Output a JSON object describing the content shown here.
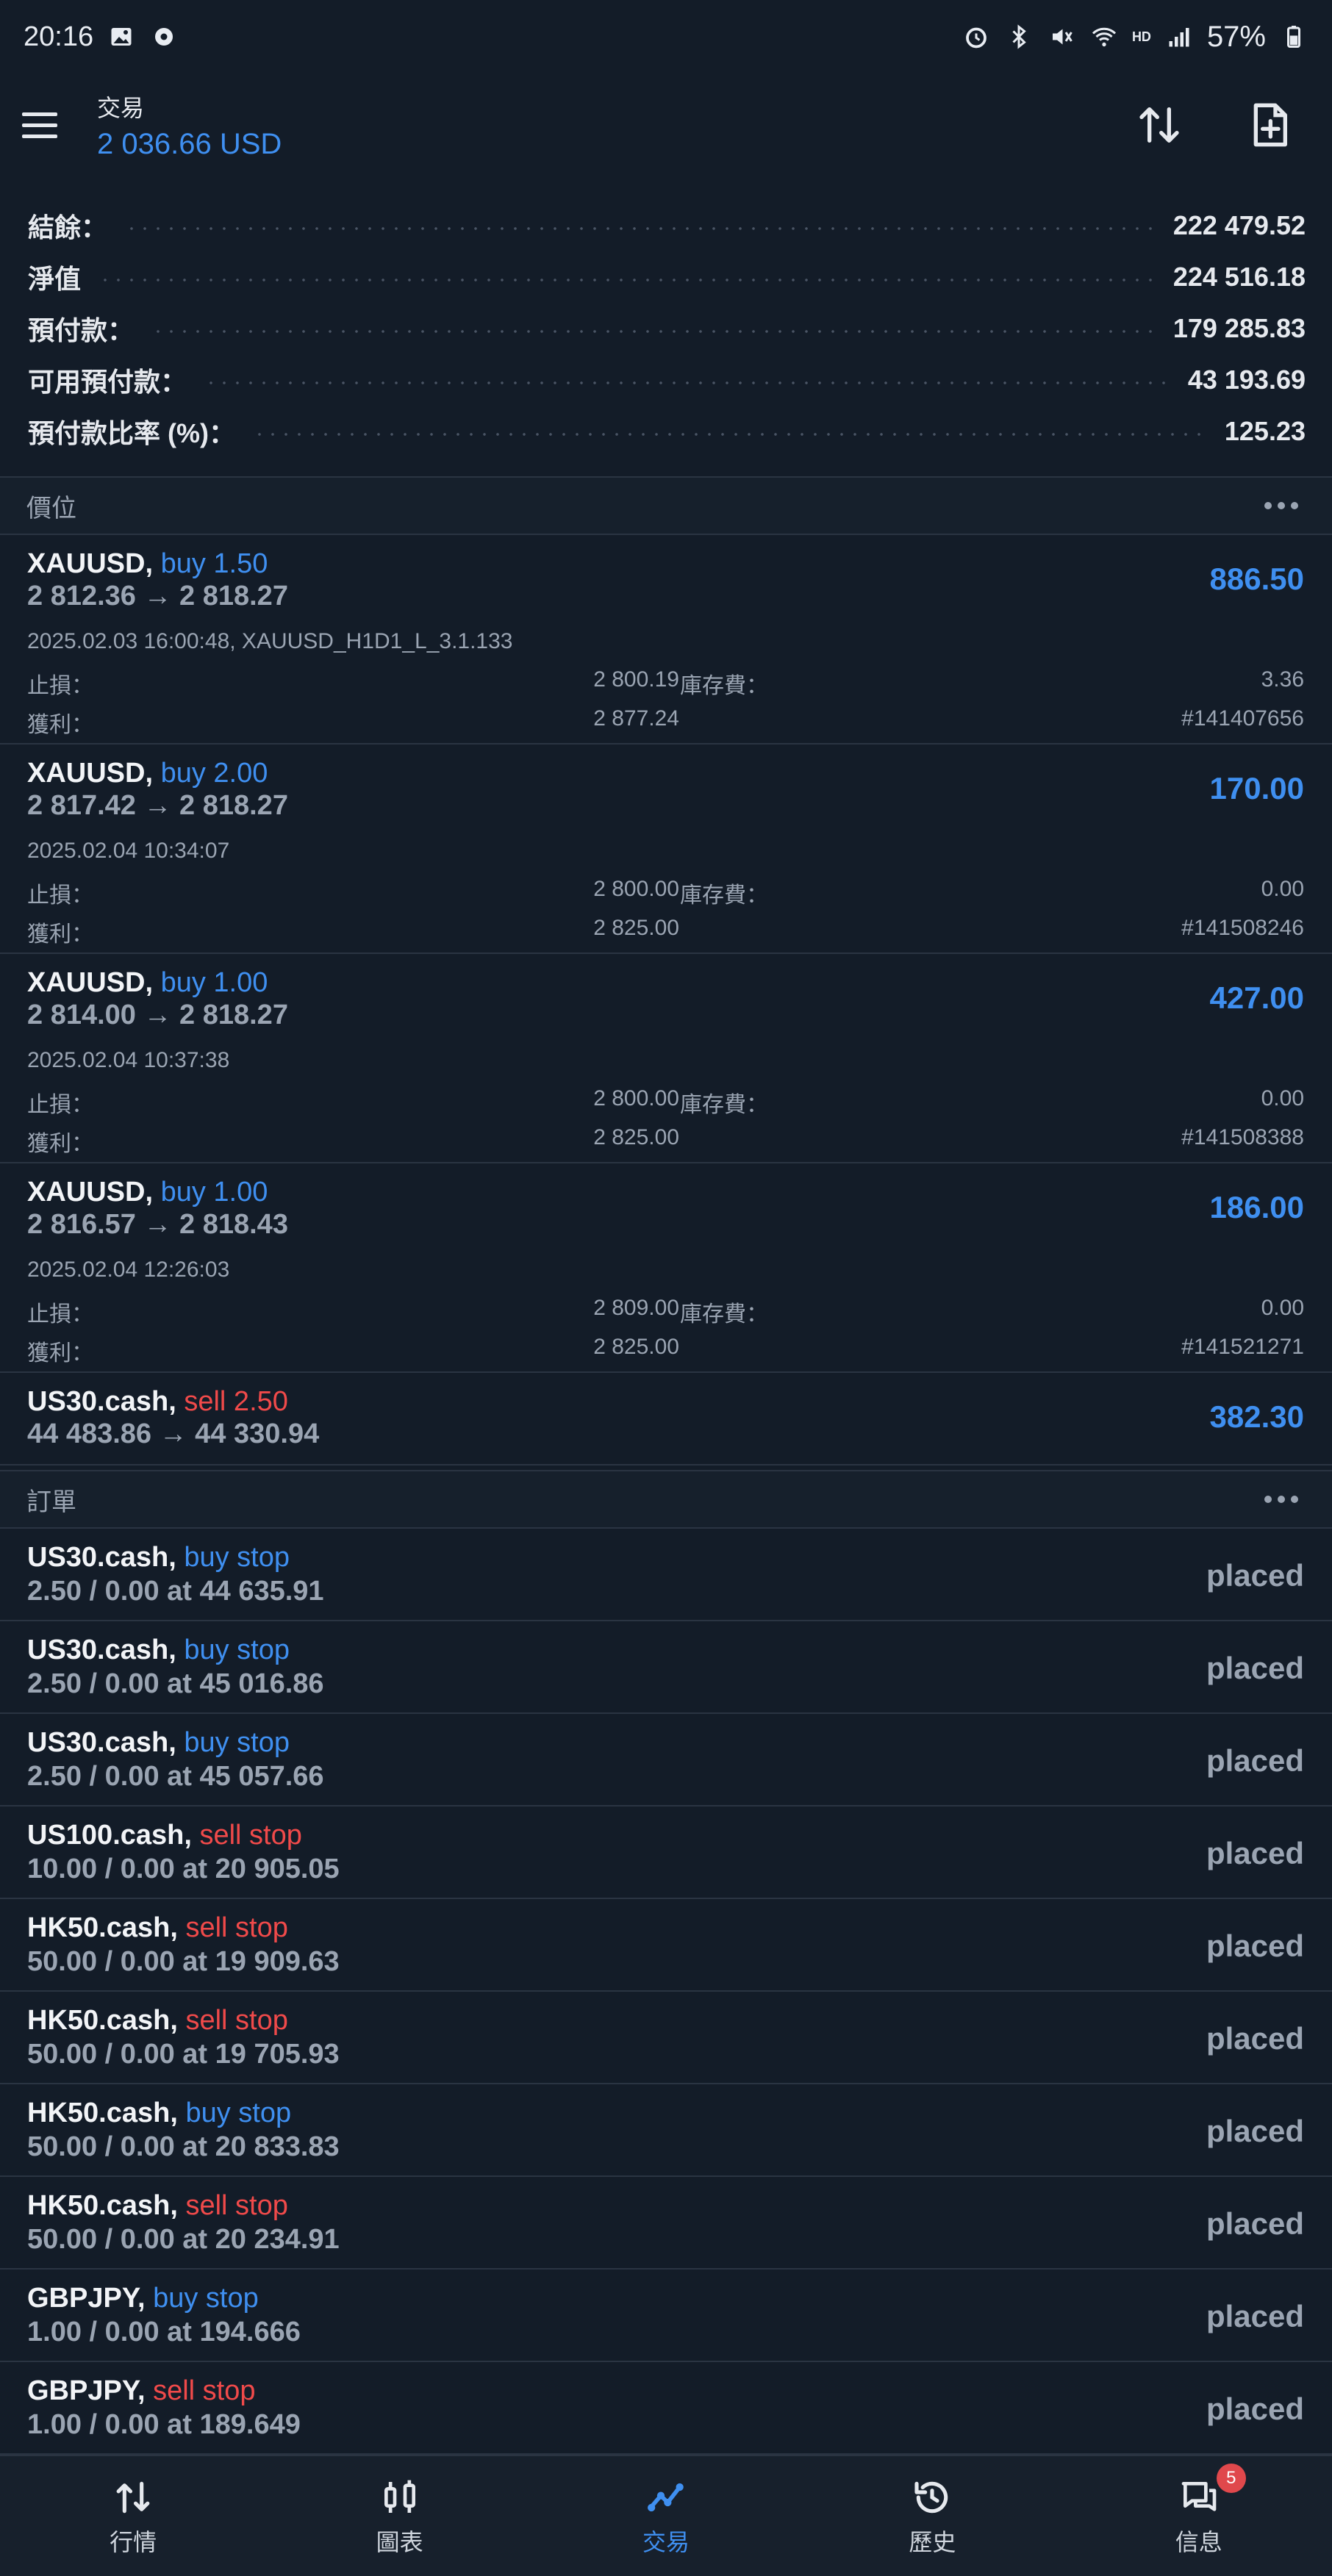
{
  "statusbar": {
    "time": "20:16",
    "hd": "HD",
    "battery": "57%"
  },
  "header": {
    "title": "交易",
    "balance": "2 036.66 USD"
  },
  "summary": [
    {
      "label": "結餘：",
      "value": "222 479.52"
    },
    {
      "label": "淨值",
      "value": "224 516.18"
    },
    {
      "label": "預付款：",
      "value": "179 285.83"
    },
    {
      "label": "可用預付款：",
      "value": "43 193.69"
    },
    {
      "label": "預付款比率 (%)：",
      "value": "125.23"
    }
  ],
  "positions_header": "價位",
  "positions": [
    {
      "symbol": "XAUUSD,",
      "side": "buy 1.50",
      "prices": "2 812.36 → 2 818.27",
      "profit": "886.50",
      "time": "2025.02.03 16:00:48, XAUUSD_H1D1_L_3.1.133",
      "sl_label": "止損：",
      "sl": "2 800.19",
      "swap_label": "庫存費：",
      "swap": "3.36",
      "tp_label": "獲利：",
      "tp": "2 877.24",
      "ticket": "#141407656"
    },
    {
      "symbol": "XAUUSD,",
      "side": "buy 2.00",
      "prices": "2 817.42 → 2 818.27",
      "profit": "170.00",
      "time": "2025.02.04 10:34:07",
      "sl_label": "止損：",
      "sl": "2 800.00",
      "swap_label": "庫存費：",
      "swap": "0.00",
      "tp_label": "獲利：",
      "tp": "2 825.00",
      "ticket": "#141508246"
    },
    {
      "symbol": "XAUUSD,",
      "side": "buy 1.00",
      "prices": "2 814.00 → 2 818.27",
      "profit": "427.00",
      "time": "2025.02.04 10:37:38",
      "sl_label": "止損：",
      "sl": "2 800.00",
      "swap_label": "庫存費：",
      "swap": "0.00",
      "tp_label": "獲利：",
      "tp": "2 825.00",
      "ticket": "#141508388"
    },
    {
      "symbol": "XAUUSD,",
      "side": "buy 1.00",
      "prices": "2 816.57 → 2 818.43",
      "profit": "186.00",
      "time": "2025.02.04 12:26:03",
      "sl_label": "止損：",
      "sl": "2 809.00",
      "swap_label": "庫存費：",
      "swap": "0.00",
      "tp_label": "獲利：",
      "tp": "2 825.00",
      "ticket": "#141521271"
    }
  ],
  "position_short": {
    "symbol": "US30.cash,",
    "side": "sell 2.50",
    "prices": "44 483.86 → 44 330.94",
    "profit": "382.30"
  },
  "orders_header": "訂單",
  "orders": [
    {
      "symbol": "US30.cash,",
      "type": "buy stop",
      "detail": "2.50 / 0.00 at 44 635.91",
      "status": "placed"
    },
    {
      "symbol": "US30.cash,",
      "type": "buy stop",
      "detail": "2.50 / 0.00 at 45 016.86",
      "status": "placed"
    },
    {
      "symbol": "US30.cash,",
      "type": "buy stop",
      "detail": "2.50 / 0.00 at 45 057.66",
      "status": "placed"
    },
    {
      "symbol": "US100.cash,",
      "type": "sell stop",
      "detail": "10.00 / 0.00 at 20 905.05",
      "status": "placed"
    },
    {
      "symbol": "HK50.cash,",
      "type": "sell stop",
      "detail": "50.00 / 0.00 at 19 909.63",
      "status": "placed"
    },
    {
      "symbol": "HK50.cash,",
      "type": "sell stop",
      "detail": "50.00 / 0.00 at 19 705.93",
      "status": "placed"
    },
    {
      "symbol": "HK50.cash,",
      "type": "buy stop",
      "detail": "50.00 / 0.00 at 20 833.83",
      "status": "placed"
    },
    {
      "symbol": "HK50.cash,",
      "type": "sell stop",
      "detail": "50.00 / 0.00 at 20 234.91",
      "status": "placed"
    },
    {
      "symbol": "GBPJPY,",
      "type": "buy stop",
      "detail": "1.00 / 0.00 at 194.666",
      "status": "placed"
    },
    {
      "symbol": "GBPJPY,",
      "type": "sell stop",
      "detail": "1.00 / 0.00 at 189.649",
      "status": "placed"
    }
  ],
  "nav": [
    {
      "label": "行情",
      "icon": "quotes-icon"
    },
    {
      "label": "圖表",
      "icon": "chart-icon"
    },
    {
      "label": "交易",
      "icon": "trade-icon",
      "active": true
    },
    {
      "label": "歷史",
      "icon": "history-icon"
    },
    {
      "label": "信息",
      "icon": "messages-icon",
      "badge": "5"
    }
  ],
  "colors": {
    "background": "#131c28",
    "accent": "#3f8ff0",
    "sell": "#f04a4a",
    "muted": "#9aa4b2"
  }
}
